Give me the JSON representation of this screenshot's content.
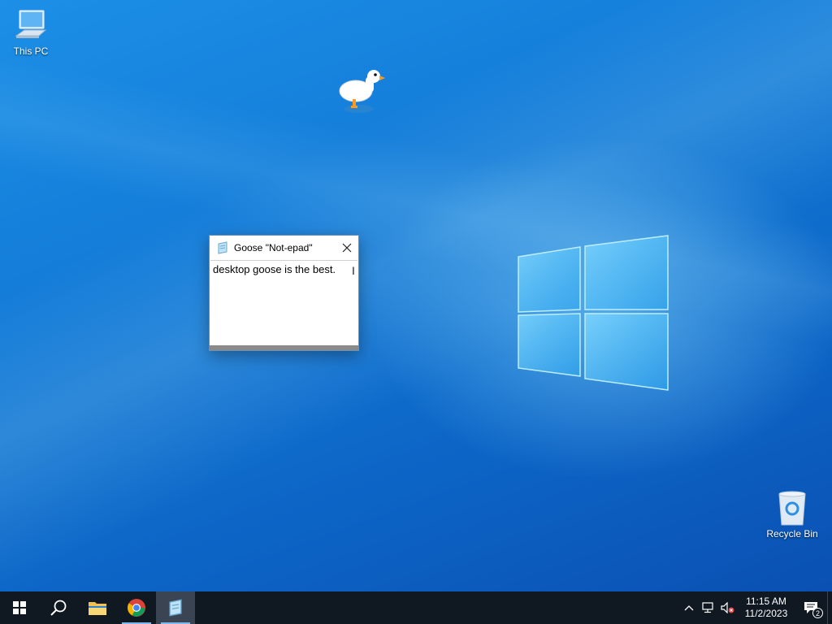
{
  "desktop": {
    "icons": [
      {
        "label": "This PC",
        "icon": "computer-icon"
      },
      {
        "label": "Recycle Bin",
        "icon": "recycle-bin-icon"
      }
    ]
  },
  "notepad": {
    "title": "Goose \"Not-epad\"",
    "text": "desktop goose is the best.",
    "icon": "notepad-icon",
    "close_icon": "close-icon"
  },
  "taskbar": {
    "items": [
      {
        "name": "start",
        "icon": "windows-start-icon"
      },
      {
        "name": "search",
        "icon": "search-icon"
      },
      {
        "name": "file-explorer",
        "icon": "folder-icon"
      },
      {
        "name": "chrome",
        "icon": "chrome-icon"
      },
      {
        "name": "goose-notepad",
        "icon": "notepad-icon",
        "active": true
      }
    ],
    "tray": {
      "icons": [
        "chevron-up-icon",
        "network-icon",
        "volume-muted-icon"
      ],
      "time": "11:15 AM",
      "date": "11/2/2023",
      "notification_count": "2"
    }
  },
  "colors": {
    "taskbar": "#101822",
    "accent": "#7fb8ee",
    "desktop": "#1279d6"
  }
}
